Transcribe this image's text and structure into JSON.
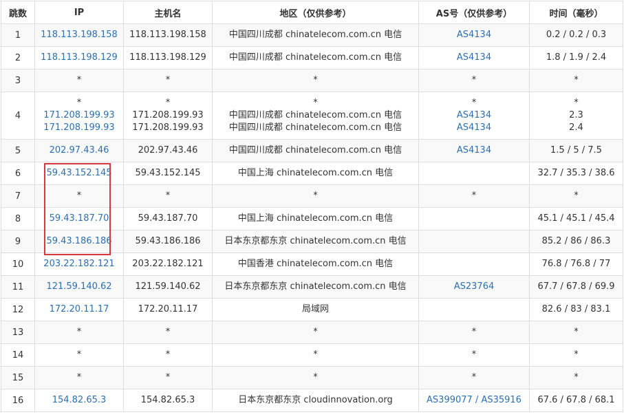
{
  "headers": [
    "跳数",
    "IP",
    "主机名",
    "地区（仅供参考）",
    "AS号（仅供参考）",
    "时间（毫秒）"
  ],
  "rows": [
    {
      "hop": "1",
      "ip": [
        "118.113.198.158"
      ],
      "host": [
        "118.113.198.158"
      ],
      "region": [
        "中国四川成都 chinatelecom.com.cn 电信"
      ],
      "as": [
        "AS4134"
      ],
      "time": [
        "0.2 / 0.2 / 0.3"
      ]
    },
    {
      "hop": "2",
      "ip": [
        "118.113.198.129"
      ],
      "host": [
        "118.113.198.129"
      ],
      "region": [
        "中国四川成都 chinatelecom.com.cn 电信"
      ],
      "as": [
        "AS4134"
      ],
      "time": [
        "1.8 / 1.9 / 2.4"
      ]
    },
    {
      "hop": "3",
      "ip": [
        "*"
      ],
      "host": [
        "*"
      ],
      "region": [
        "*"
      ],
      "as": [
        "*"
      ],
      "time": [
        "*"
      ]
    },
    {
      "hop": "4",
      "ip": [
        "*",
        "171.208.199.93",
        "171.208.199.93"
      ],
      "host": [
        "*",
        "171.208.199.93",
        "171.208.199.93"
      ],
      "region": [
        "*",
        "中国四川成都 chinatelecom.com.cn 电信",
        "中国四川成都 chinatelecom.com.cn 电信"
      ],
      "as": [
        "*",
        "AS4134",
        "AS4134"
      ],
      "time": [
        "*",
        "2.3",
        "2.4"
      ]
    },
    {
      "hop": "5",
      "ip": [
        "202.97.43.46"
      ],
      "host": [
        "202.97.43.46"
      ],
      "region": [
        "中国四川成都 chinatelecom.com.cn 电信"
      ],
      "as": [
        "AS4134"
      ],
      "time": [
        "1.5 / 5 / 7.5"
      ]
    },
    {
      "hop": "6",
      "ip": [
        "59.43.152.145"
      ],
      "host": [
        "59.43.152.145"
      ],
      "region": [
        "中国上海 chinatelecom.com.cn 电信"
      ],
      "as": [
        ""
      ],
      "time": [
        "32.7 / 35.3 / 38.6"
      ]
    },
    {
      "hop": "7",
      "ip": [
        "*"
      ],
      "host": [
        "*"
      ],
      "region": [
        "*"
      ],
      "as": [
        "*"
      ],
      "time": [
        "*"
      ]
    },
    {
      "hop": "8",
      "ip": [
        "59.43.187.70"
      ],
      "host": [
        "59.43.187.70"
      ],
      "region": [
        "中国上海 chinatelecom.com.cn 电信"
      ],
      "as": [
        ""
      ],
      "time": [
        "45.1 / 45.1 / 45.4"
      ]
    },
    {
      "hop": "9",
      "ip": [
        "59.43.186.186"
      ],
      "host": [
        "59.43.186.186"
      ],
      "region": [
        "日本东京都东京 chinatelecom.com.cn 电信"
      ],
      "as": [
        ""
      ],
      "time": [
        "85.2 / 86 / 86.3"
      ]
    },
    {
      "hop": "10",
      "ip": [
        "203.22.182.121"
      ],
      "host": [
        "203.22.182.121"
      ],
      "region": [
        "中国香港 chinatelecom.com.cn 电信"
      ],
      "as": [
        ""
      ],
      "time": [
        "76.8 / 76.8 / 77"
      ]
    },
    {
      "hop": "11",
      "ip": [
        "121.59.140.62"
      ],
      "host": [
        "121.59.140.62"
      ],
      "region": [
        "日本东京都东京 chinatelecom.com.cn 电信"
      ],
      "as": [
        "AS23764"
      ],
      "time": [
        "67.7 / 67.8 / 69.9"
      ]
    },
    {
      "hop": "12",
      "ip": [
        "172.20.11.17"
      ],
      "host": [
        "172.20.11.17"
      ],
      "region": [
        "局域网"
      ],
      "as": [
        ""
      ],
      "time": [
        "82.6 / 83 / 83.1"
      ]
    },
    {
      "hop": "13",
      "ip": [
        "*"
      ],
      "host": [
        "*"
      ],
      "region": [
        "*"
      ],
      "as": [
        "*"
      ],
      "time": [
        "*"
      ]
    },
    {
      "hop": "14",
      "ip": [
        "*"
      ],
      "host": [
        "*"
      ],
      "region": [
        "*"
      ],
      "as": [
        "*"
      ],
      "time": [
        "*"
      ]
    },
    {
      "hop": "15",
      "ip": [
        "*"
      ],
      "host": [
        "*"
      ],
      "region": [
        "*"
      ],
      "as": [
        "*"
      ],
      "time": [
        "*"
      ]
    },
    {
      "hop": "16",
      "ip": [
        "154.82.65.3"
      ],
      "host": [
        "154.82.65.3"
      ],
      "region": [
        "日本东京都东京 cloudinnovation.org"
      ],
      "as": [
        "AS399077 / AS35916"
      ],
      "time": [
        "67.6 / 67.8 / 68.1"
      ]
    }
  ],
  "colors": {
    "link": "#2a6fb3",
    "highlight": "#d9363e",
    "border": "#dddddd",
    "stripe": "#f9f9f9"
  }
}
